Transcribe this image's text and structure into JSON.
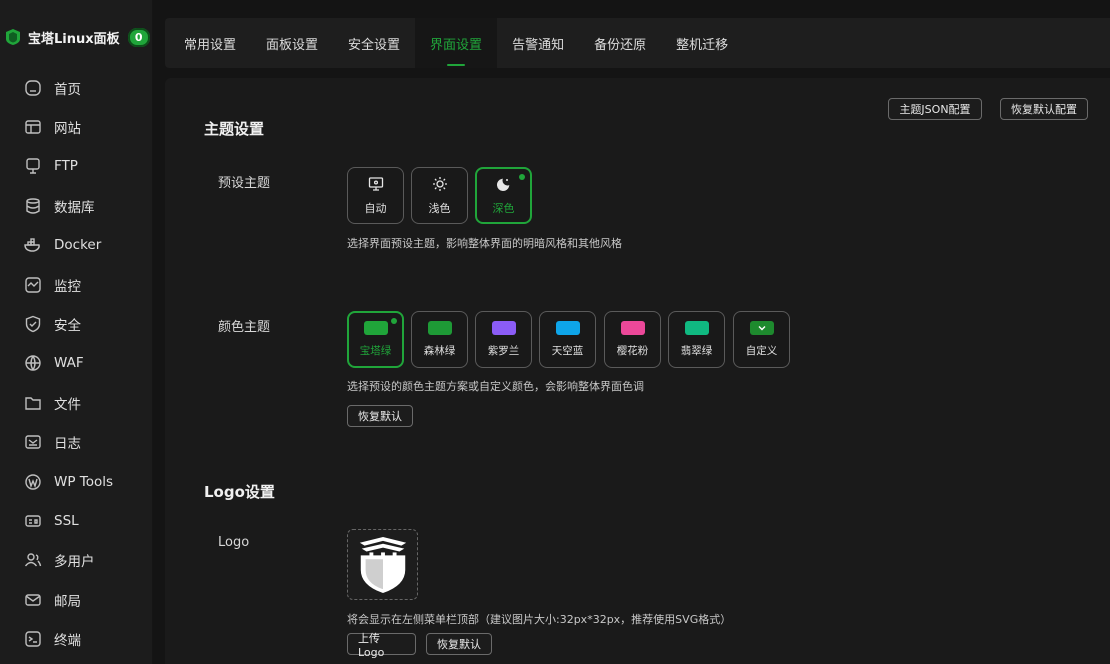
{
  "brand": {
    "title": "宝塔Linux面板",
    "badge": "0"
  },
  "sidebar": {
    "items": [
      {
        "label": "首页",
        "icon": "home-icon"
      },
      {
        "label": "网站",
        "icon": "website-icon"
      },
      {
        "label": "FTP",
        "icon": "ftp-icon"
      },
      {
        "label": "数据库",
        "icon": "database-icon"
      },
      {
        "label": "Docker",
        "icon": "docker-icon"
      },
      {
        "label": "监控",
        "icon": "monitor-icon"
      },
      {
        "label": "安全",
        "icon": "shield-icon"
      },
      {
        "label": "WAF",
        "icon": "waf-icon"
      },
      {
        "label": "文件",
        "icon": "folder-icon"
      },
      {
        "label": "日志",
        "icon": "log-icon"
      },
      {
        "label": "WP Tools",
        "icon": "wordpress-icon"
      },
      {
        "label": "SSL",
        "icon": "ssl-icon"
      },
      {
        "label": "多用户",
        "icon": "users-icon"
      },
      {
        "label": "邮局",
        "icon": "mail-icon"
      },
      {
        "label": "终端",
        "icon": "terminal-icon"
      }
    ]
  },
  "tabs": [
    {
      "label": "常用设置",
      "active": false
    },
    {
      "label": "面板设置",
      "active": false
    },
    {
      "label": "安全设置",
      "active": false
    },
    {
      "label": "界面设置",
      "active": true
    },
    {
      "label": "告警通知",
      "active": false
    },
    {
      "label": "备份还原",
      "active": false
    },
    {
      "label": "整机迁移",
      "active": false
    }
  ],
  "header_buttons": {
    "theme_json": "主题JSON配置",
    "restore_default": "恢复默认配置"
  },
  "theme_section": {
    "title": "主题设置",
    "preset_label": "预设主题",
    "presets": [
      {
        "label": "自动",
        "icon": "monitor-screen-icon"
      },
      {
        "label": "浅色",
        "icon": "sun-icon"
      },
      {
        "label": "深色",
        "icon": "moon-icon",
        "selected": true
      }
    ],
    "preset_help": "选择界面预设主题，影响整体界面的明暗风格和其他风格",
    "color_label": "颜色主题",
    "colors": [
      {
        "label": "宝塔绿",
        "color": "#20a53a",
        "selected": true
      },
      {
        "label": "森林绿",
        "color": "#1e9a36"
      },
      {
        "label": "紫罗兰",
        "color": "#8b5cf6"
      },
      {
        "label": "天空蓝",
        "color": "#0ea5e9"
      },
      {
        "label": "樱花粉",
        "color": "#ec4899"
      },
      {
        "label": "翡翠绿",
        "color": "#10b981"
      },
      {
        "label": "自定义",
        "color": "#1e8a2e"
      }
    ],
    "color_help": "选择预设的颜色主题方案或自定义颜色，会影响整体界面色调",
    "restore_button": "恢复默认"
  },
  "logo_section": {
    "title": "Logo设置",
    "logo_label": "Logo",
    "help": "将会显示在左侧菜单栏顶部（建议图片大小:32px*32px，推荐使用SVG格式）",
    "upload_button": "上传Logo",
    "restore_button": "恢复默认"
  },
  "colors": {
    "accent": "#20a53a",
    "background": "#141414",
    "panel": "#1a1a1a"
  }
}
